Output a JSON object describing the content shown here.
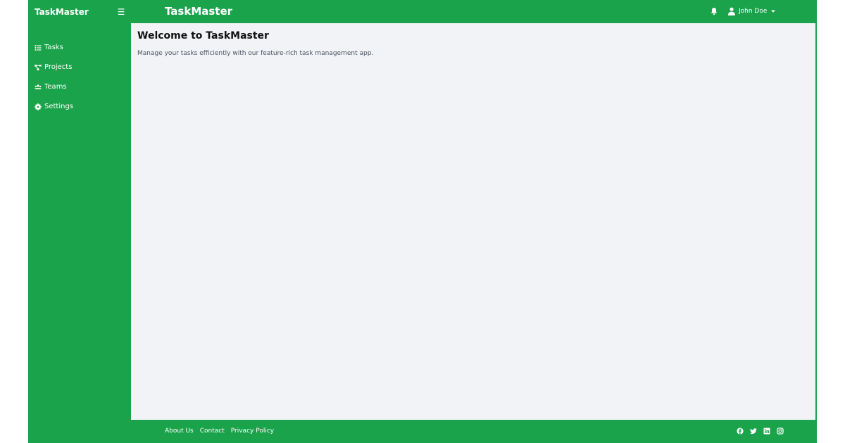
{
  "colors": {
    "brand_green": "#1aa34a",
    "main_background": "#f2f3f6",
    "text_dark": "#111111",
    "text_muted": "#4b5563"
  },
  "sidebar": {
    "brand": "TaskMaster",
    "toggle_icon": "hamburger-icon",
    "items": [
      {
        "label": "Tasks",
        "icon": "list-icon"
      },
      {
        "label": "Projects",
        "icon": "project-diagram-icon"
      },
      {
        "label": "Teams",
        "icon": "users-icon"
      },
      {
        "label": "Settings",
        "icon": "gear-icon"
      }
    ]
  },
  "header": {
    "title": "TaskMaster",
    "notification_icon": "bell-icon",
    "user": {
      "name": "John Doe",
      "icon": "user-icon",
      "caret_icon": "caret-down-icon"
    }
  },
  "main": {
    "title": "Welcome to TaskMaster",
    "description": "Manage your tasks efficiently with our feature-rich task management app."
  },
  "footer": {
    "links": [
      "About Us",
      "Contact",
      "Privacy Policy"
    ],
    "social_icons": [
      "facebook-icon",
      "twitter-icon",
      "linkedin-icon",
      "instagram-icon"
    ]
  }
}
